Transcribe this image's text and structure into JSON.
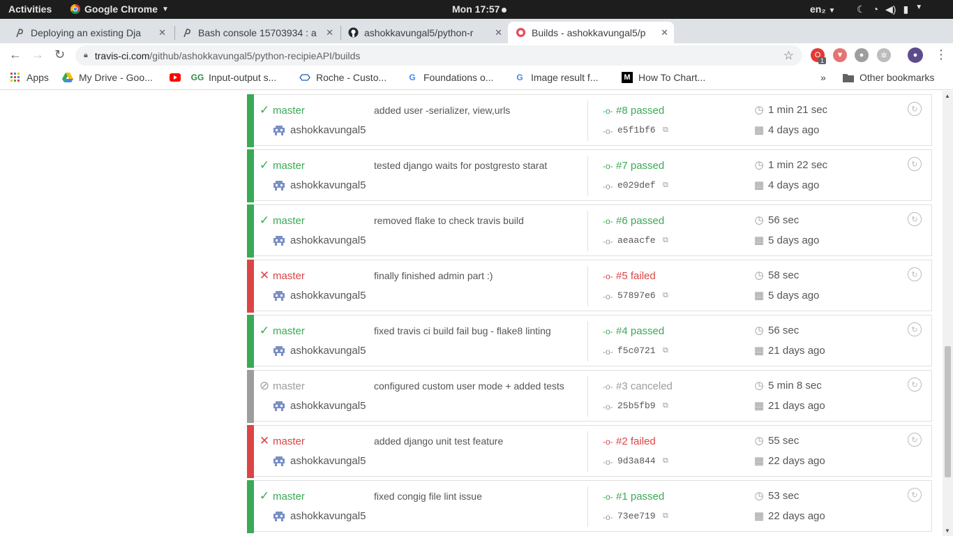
{
  "topbar": {
    "activities": "Activities",
    "app_name": "Google Chrome",
    "clock": "Mon 17:57",
    "language": "en₂"
  },
  "tabs": [
    {
      "title": "Deploying an existing Dja"
    },
    {
      "title": "Bash console 15703934 : a"
    },
    {
      "title": "ashokkavungal5/python-r"
    },
    {
      "title": "Builds - ashokkavungal5/p"
    }
  ],
  "omnibox": {
    "host": "travis-ci.com",
    "path": "/github/ashokkavungal5/python-recipieAPI/builds"
  },
  "extensions": {
    "badge_count": "1"
  },
  "bookmarks": [
    {
      "label": "Apps"
    },
    {
      "label": "My Drive - Goo..."
    },
    {
      "label": ""
    },
    {
      "label": "Input-output s..."
    },
    {
      "label": "Roche - Custo..."
    },
    {
      "label": "Foundations o..."
    },
    {
      "label": "Image result f..."
    },
    {
      "label": "How To Chart..."
    }
  ],
  "bookmarks_more": "»",
  "other_bookmarks": "Other bookmarks",
  "builds": [
    {
      "status": "passed",
      "branch": "master",
      "author": "ashokkavungal5",
      "message": "added user -serializer, view,urls",
      "number": "#8 passed",
      "sha": "e5f1bf6",
      "duration": "1 min 21 sec",
      "date": "4 days ago"
    },
    {
      "status": "passed",
      "branch": "master",
      "author": "ashokkavungal5",
      "message": "tested django waits for postgresto starat",
      "number": "#7 passed",
      "sha": "e029def",
      "duration": "1 min 22 sec",
      "date": "4 days ago"
    },
    {
      "status": "passed",
      "branch": "master",
      "author": "ashokkavungal5",
      "message": "removed flake to check travis build",
      "number": "#6 passed",
      "sha": "aeaacfe",
      "duration": "56 sec",
      "date": "5 days ago"
    },
    {
      "status": "failed",
      "branch": "master",
      "author": "ashokkavungal5",
      "message": "finally finished admin part :)",
      "number": "#5 failed",
      "sha": "57897e6",
      "duration": "58 sec",
      "date": "5 days ago"
    },
    {
      "status": "passed",
      "branch": "master",
      "author": "ashokkavungal5",
      "message": "fixed travis ci build fail bug - flake8 linting",
      "number": "#4 passed",
      "sha": "f5c0721",
      "duration": "56 sec",
      "date": "21 days ago"
    },
    {
      "status": "canceled",
      "branch": "master",
      "author": "ashokkavungal5",
      "message": "configured custom user mode + added tests",
      "number": "#3 canceled",
      "sha": "25b5fb9",
      "duration": "5 min 8 sec",
      "date": "21 days ago"
    },
    {
      "status": "failed",
      "branch": "master",
      "author": "ashokkavungal5",
      "message": "added django unit test feature",
      "number": "#2 failed",
      "sha": "9d3a844",
      "duration": "55 sec",
      "date": "22 days ago"
    },
    {
      "status": "passed",
      "branch": "master",
      "author": "ashokkavungal5",
      "message": "fixed congig file lint issue",
      "number": "#1 passed",
      "sha": "73ee719",
      "duration": "53 sec",
      "date": "22 days ago"
    }
  ],
  "colors": {
    "passed": "#39aa56",
    "failed": "#db4545",
    "canceled": "#9d9d9d"
  },
  "icons": {
    "passed": "check-icon",
    "failed": "x-icon",
    "canceled": "cancel-circle-icon"
  }
}
